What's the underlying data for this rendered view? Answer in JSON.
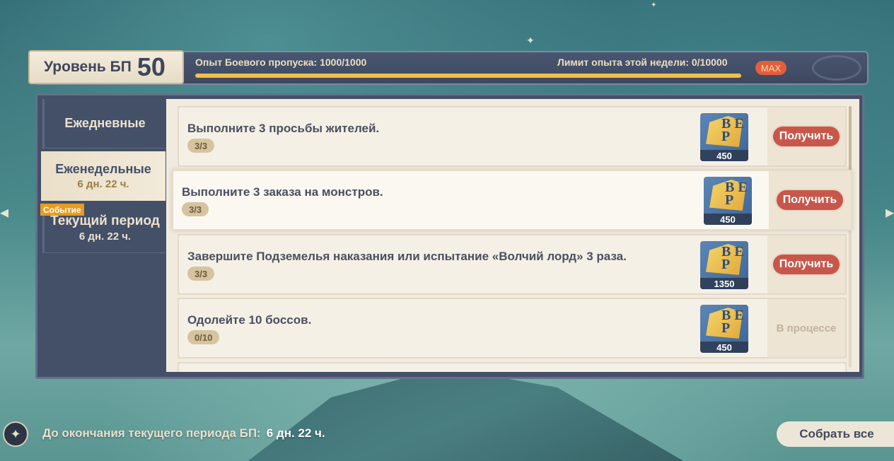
{
  "header": {
    "level_label": "Уровень БП",
    "level_value": "50",
    "xp_label": "Опыт Боевого пропуска:",
    "xp_value": "1000/1000",
    "xp_progress": 1.0,
    "week_label": "Лимит опыта этой недели:",
    "week_value": "0/10000",
    "max_badge": "MAX"
  },
  "sidebar": {
    "tabs": [
      {
        "title": "Ежедневные",
        "subtitle": ""
      },
      {
        "title": "Еженедельные",
        "subtitle": "6 дн. 22 ч."
      },
      {
        "title": "Текущий период",
        "subtitle": "6 дн. 22 ч.",
        "badge": "Событие"
      }
    ],
    "selected_index": 1
  },
  "tasks": [
    {
      "title": "Выполните 3 просьбы жителей.",
      "progress": "3/3",
      "reward": "450",
      "action": "Получить"
    },
    {
      "title": "Выполните 3 заказа на монстров.",
      "progress": "3/3",
      "reward": "450",
      "action": "Получить"
    },
    {
      "title": "Завершите Подземелья наказания или испытание «Волчий лорд» 3 раза.",
      "progress": "3/3",
      "reward": "1350",
      "action": "Получить"
    },
    {
      "title": "Одолейте 10 боссов.",
      "progress": "0/10",
      "reward": "450",
      "status": "В процессе"
    }
  ],
  "reward_icon": {
    "glyph": "B E P"
  },
  "footer": {
    "period_label": "До окончания текущего периода БП:",
    "period_value": "6 дн. 22 ч.",
    "collect_all": "Собрать все"
  },
  "colors": {
    "claim_button": "#c7574b",
    "xp_fill": "#f0c04a",
    "max_badge": "#e15f3c",
    "event_badge": "#e89c1f"
  }
}
